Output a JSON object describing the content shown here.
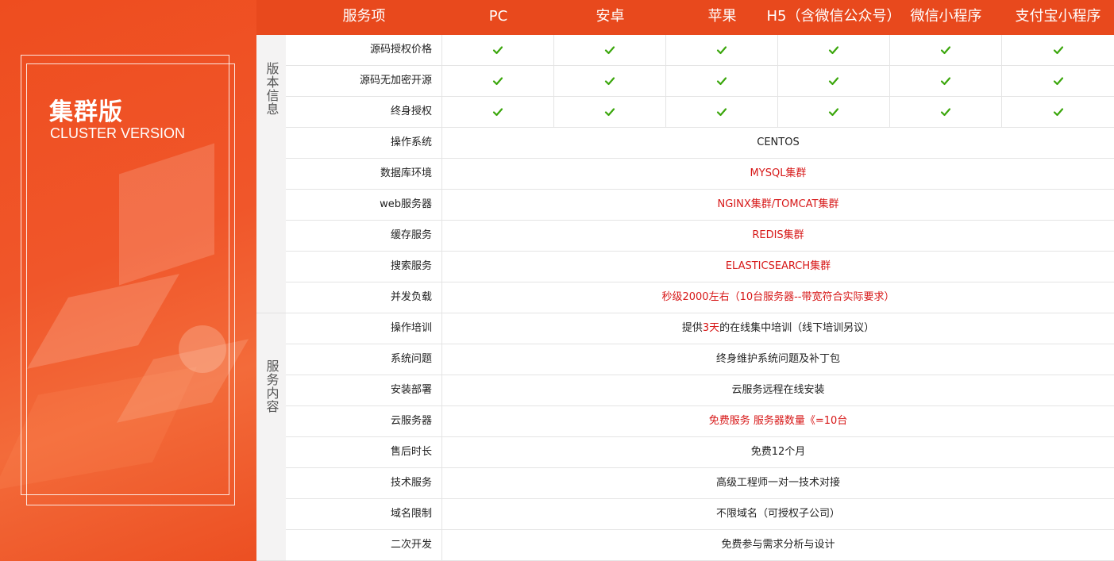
{
  "hero": {
    "title": "集群版",
    "subtitle": "CLUSTER VERSION"
  },
  "groups": [
    {
      "label": "版本信息"
    },
    {
      "label": "服务内容"
    }
  ],
  "table": {
    "headers": [
      "服务项",
      "PC",
      "安卓",
      "苹果",
      "H5（含微信公众号）",
      "微信小程序",
      "支付宝小程序"
    ],
    "check_rows": [
      {
        "label": "源码授权价格",
        "checks": [
          true,
          true,
          true,
          true,
          true,
          true
        ]
      },
      {
        "label": "源码无加密开源",
        "checks": [
          true,
          true,
          true,
          true,
          true,
          true
        ]
      },
      {
        "label": "终身授权",
        "checks": [
          true,
          true,
          true,
          true,
          true,
          true
        ]
      }
    ],
    "text_rows": [
      {
        "label": "操作系统",
        "value": "CENTOS",
        "color": "dark"
      },
      {
        "label": "数据库环境",
        "value": "MYSQL集群",
        "color": "red"
      },
      {
        "label": "web服务器",
        "value": "NGINX集群/TOMCAT集群",
        "color": "red"
      },
      {
        "label": "缓存服务",
        "value": "REDIS集群",
        "color": "red"
      },
      {
        "label": "搜索服务",
        "value": "ELASTICSEARCH集群",
        "color": "red"
      },
      {
        "label": "并发负载",
        "value": "秒级2000左右（10台服务器--带宽符合实际要求）",
        "color": "red"
      },
      {
        "label": "操作培训",
        "value_parts": [
          "提供",
          "3天",
          "的在线集中培训（线下培训另议）"
        ],
        "color": "dark"
      },
      {
        "label": "系统问题",
        "value": "终身维护系统问题及补丁包",
        "color": "dark"
      },
      {
        "label": "安装部署",
        "value": "云服务远程在线安装",
        "color": "dark"
      },
      {
        "label": "云服务器",
        "value": "免费服务  服务器数量《=10台",
        "color": "red"
      },
      {
        "label": "售后时长",
        "value": "免费12个月",
        "color": "dark"
      },
      {
        "label": "技术服务",
        "value": "高级工程师一对一技术对接",
        "color": "dark"
      },
      {
        "label": "域名限制",
        "value": "不限域名（可授权子公司）",
        "color": "dark"
      },
      {
        "label": "二次开发",
        "value": "免费参与需求分析与设计",
        "color": "dark"
      }
    ]
  },
  "colors": {
    "accent": "#e8491d",
    "check": "#3aa60b",
    "highlight": "#d71818"
  },
  "icons": {
    "check": "check-icon"
  }
}
